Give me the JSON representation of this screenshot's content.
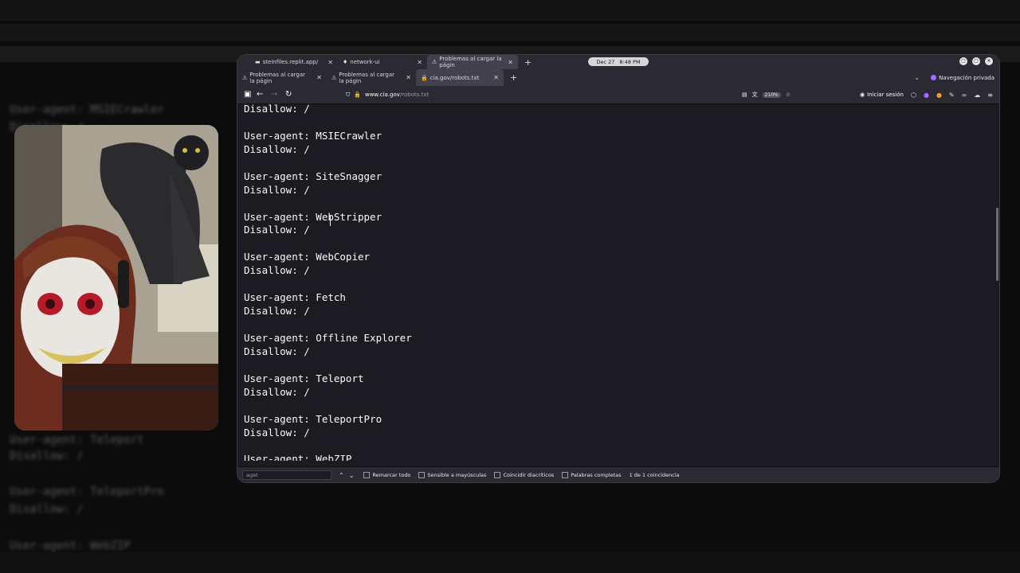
{
  "browser": {
    "top_tabs": [
      {
        "label": "steinfiles.replit.app/",
        "icon": "replit-icon"
      },
      {
        "label": "network-ui",
        "icon": "pin-icon"
      },
      {
        "label": "Problemas al cargar la págin",
        "icon": "warning-icon"
      }
    ],
    "clock": {
      "date": "Dec 27",
      "time": "8:48 PM"
    },
    "tabs": [
      {
        "label": "Problemas al cargar la págin",
        "icon": "warning-icon"
      },
      {
        "label": "Problemas al cargar la págin",
        "icon": "warning-icon"
      },
      {
        "label": "cia.gov/robots.txt",
        "icon": "lock-icon"
      }
    ],
    "private_label": "Navegación privada",
    "url": {
      "host": "www.cia.gov",
      "path": "/robots.txt"
    },
    "zoom": "210%",
    "login_label": "Iniciar sesión"
  },
  "content": {
    "lines": [
      "Disallow: /",
      "",
      "User-agent: MSIECrawler",
      "Disallow: /",
      "",
      "User-agent: SiteSnagger",
      "Disallow: /",
      "",
      "User-agent: WebStripper",
      "Disallow: /",
      "",
      "User-agent: WebCopier",
      "Disallow: /",
      "",
      "User-agent: Fetch",
      "Disallow: /",
      "",
      "User-agent: Offline Explorer",
      "Disallow: /",
      "",
      "User-agent: Teleport",
      "Disallow: /",
      "",
      "User-agent: TeleportPro",
      "Disallow: /",
      "",
      "User-agent: WebZIP"
    ]
  },
  "findbar": {
    "query": "aget",
    "highlight_all": "Remarcar todo",
    "match_case": "Sensible a mayúsculas",
    "match_diacritics": "Coincidir diacríticos",
    "whole_words": "Palabras completas",
    "results": "1 de 1 coincidencia"
  },
  "background_text": [
    "User-agent: MSIECrawler",
    "Disallow: /",
    "User-agent: Teleport",
    "Disallow: /",
    "User-agent: TeleportPro",
    "Disallow: /",
    "User-agent: WebZIP"
  ],
  "colors": {
    "page_bg": "#1c1b22",
    "chrome_bg": "#2b2a33",
    "text": "#fbfbfe",
    "private_accent": "#a56bff"
  }
}
